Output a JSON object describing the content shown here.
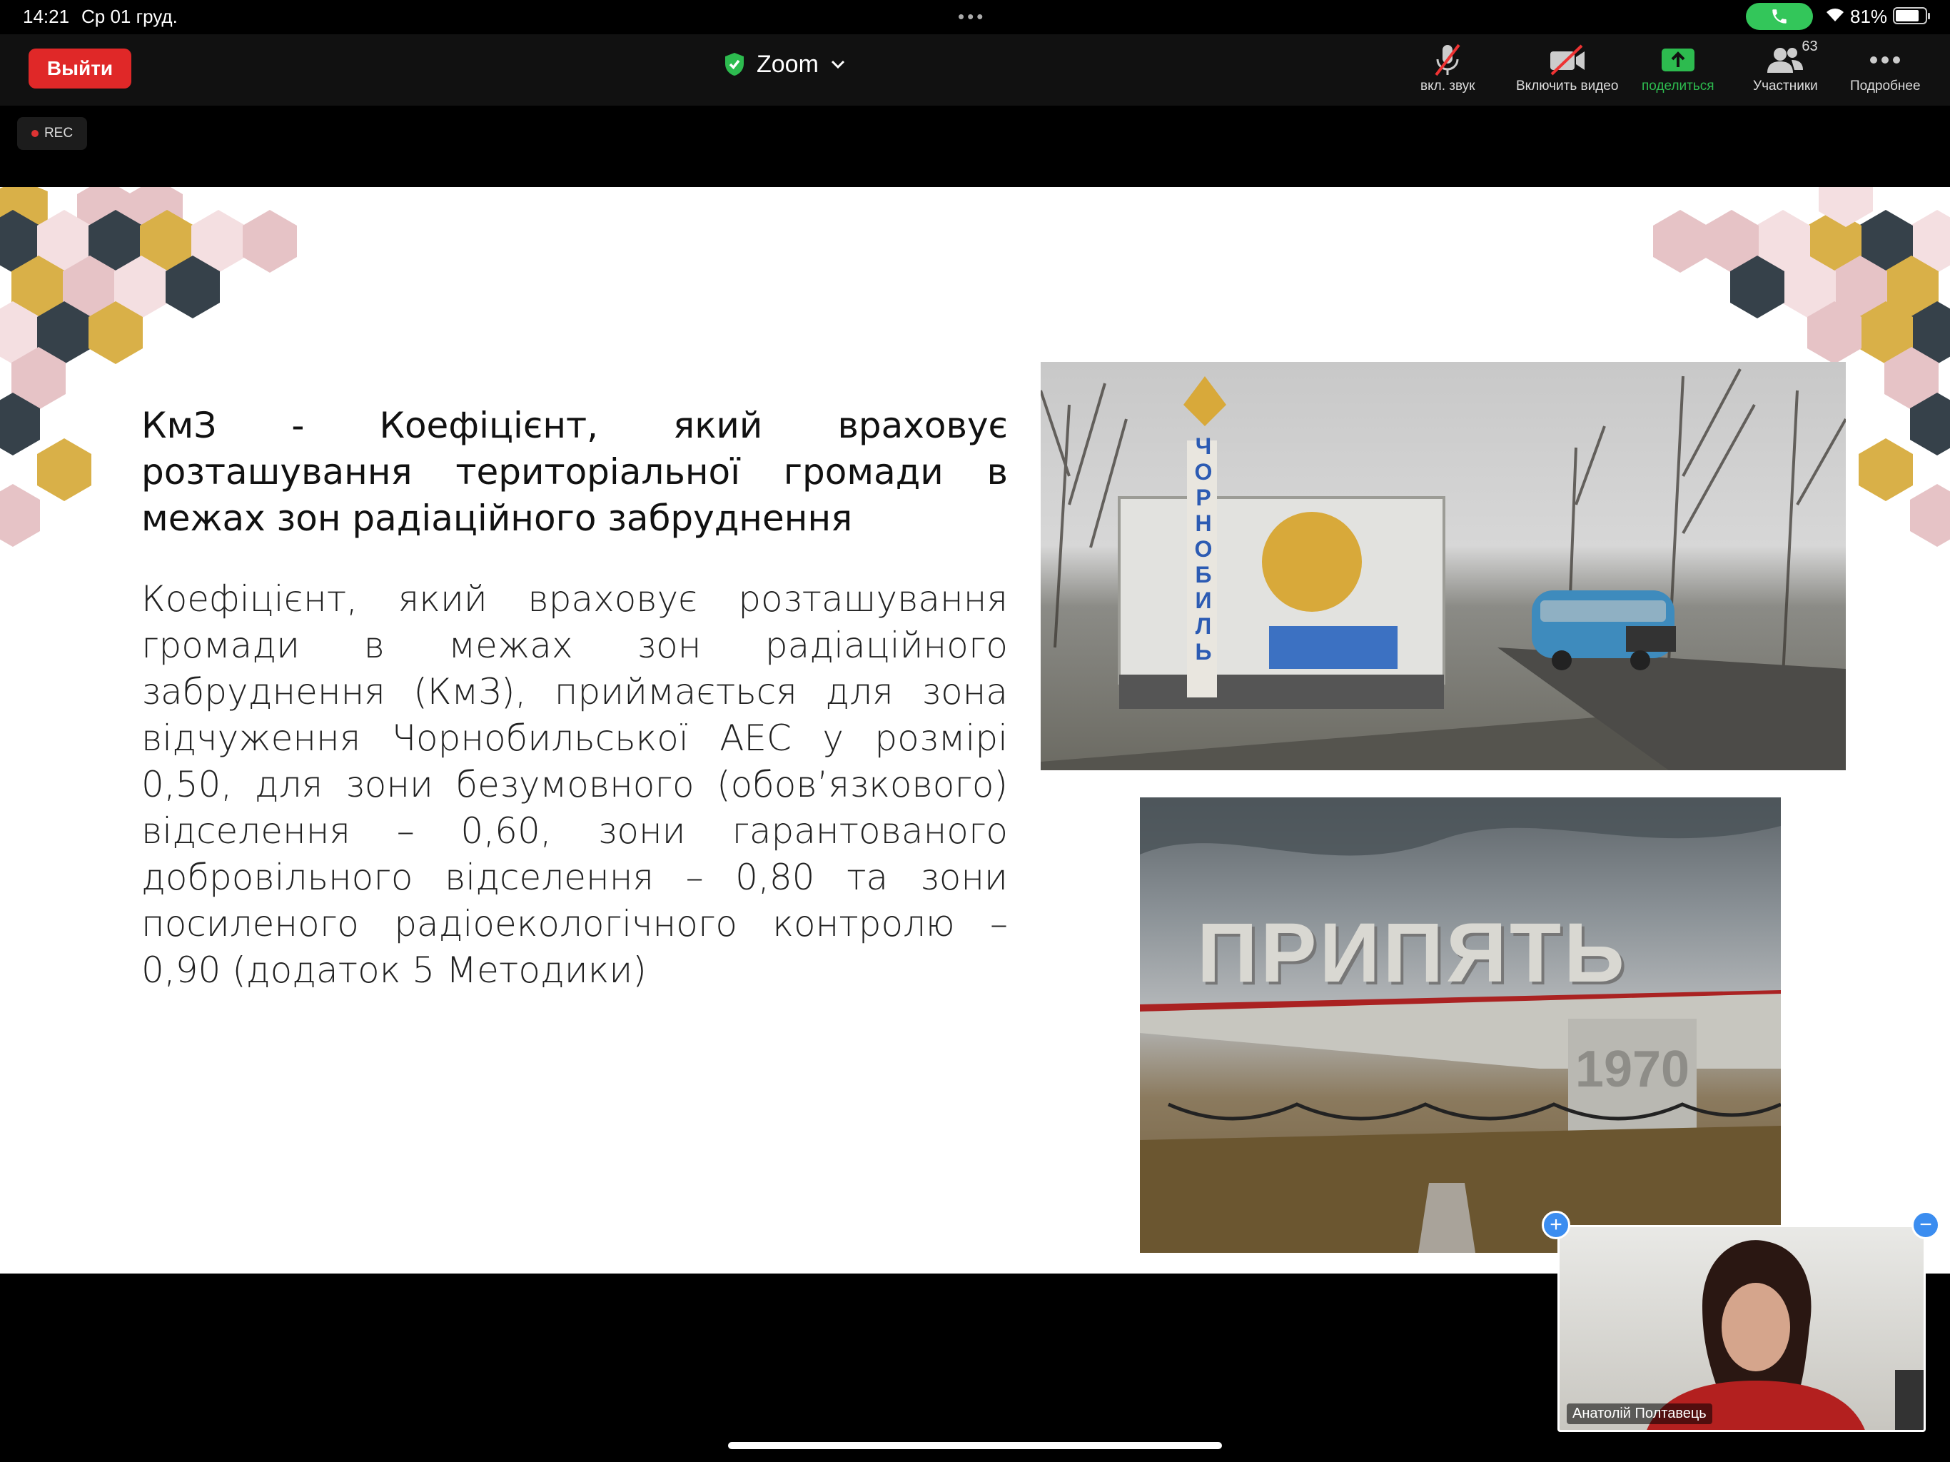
{
  "status_bar": {
    "time": "14:21",
    "date": "Ср 01 груд.",
    "battery": "81%",
    "battery_level": 0.81
  },
  "toolbar": {
    "leave_label": "Выйти",
    "app_title": "Zoom",
    "mute_label": "вкл. звук",
    "video_label": "Включить видео",
    "share_label": "поделиться",
    "participants_label": "Участники",
    "participants_count": "63",
    "more_label": "Подробнее"
  },
  "rec_label": "REC",
  "slide": {
    "heading": "КмЗ - Коефіцієнт, який враховує розташування територіальної громади в межах зон радіаційного забруднення",
    "body": "Коефіцієнт, який враховує розташування громади в межах зон радіаційного забруднення (КмЗ), приймається для зона відчуження Чорнобильської АЕС у розмірі 0,50, для зони безумовного (обов’язкового) відселення – 0,60, зони гарантованого добровільного відселення – 0,80 та зони посиленого радіоекологічного контролю – 0,90 (додаток 5 Методики)",
    "photo1_sign": "ЧОРНОБИЛЬ",
    "photo2_sign": "ПРИПЯТЬ",
    "photo2_year": "1970"
  },
  "self_view": {
    "name": "Анатолій Полтавець"
  },
  "colors": {
    "leave": "#e02828",
    "share": "#2dbb4f",
    "call": "#33c65a",
    "hex_dark": "#36414a",
    "hex_gold": "#d9b048",
    "hex_pink": "#e6c3c6"
  }
}
